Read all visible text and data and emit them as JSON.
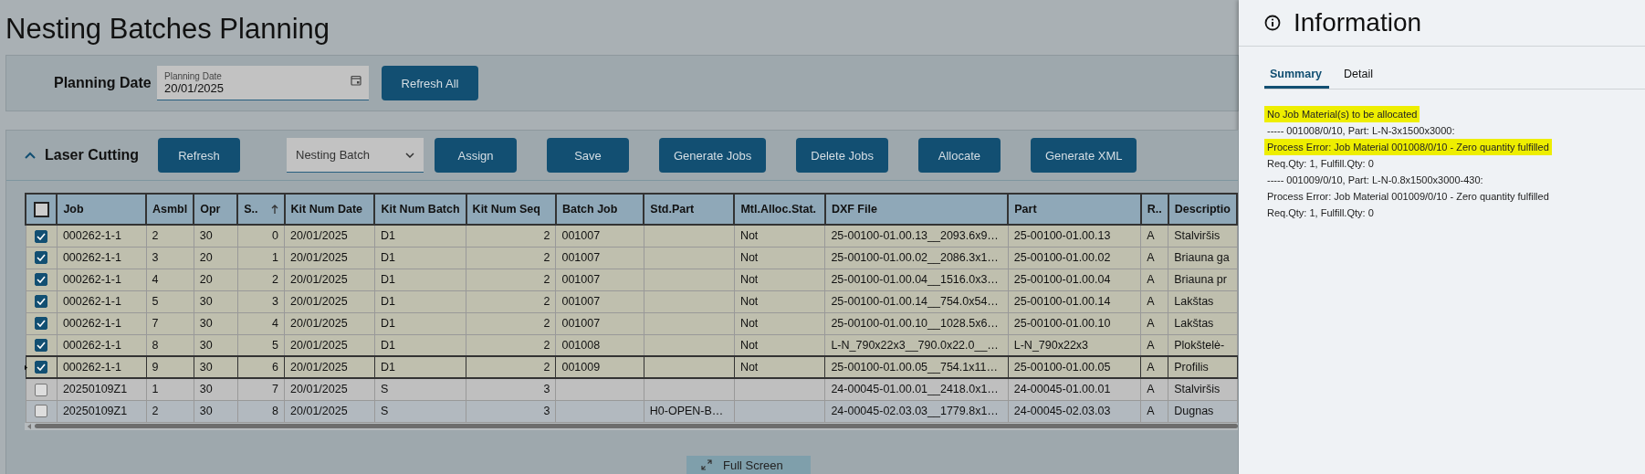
{
  "page": {
    "title": "Nesting Batches Planning"
  },
  "planning": {
    "label": "Planning Date",
    "date_field": {
      "label": "Planning Date",
      "value": "20/01/2025"
    },
    "button": "Refresh All"
  },
  "section": {
    "title": "Laser Cutting",
    "expanded": true,
    "toolbar": [
      {
        "kind": "button",
        "label": "Refresh"
      },
      {
        "kind": "dropdown",
        "label": "Nesting Batch"
      },
      {
        "kind": "button",
        "label": "Assign"
      },
      {
        "kind": "button",
        "label": "Save"
      },
      {
        "kind": "button",
        "label": "Generate Jobs"
      },
      {
        "kind": "button",
        "label": "Delete Jobs"
      },
      {
        "kind": "button",
        "label": "Allocate"
      },
      {
        "kind": "button",
        "label": "Generate XML"
      }
    ],
    "table": {
      "all_checked": false,
      "columns": [
        {
          "label": "Job",
          "kind": "text",
          "sorted": false
        },
        {
          "label": "Asmbl",
          "kind": "text",
          "sorted": false
        },
        {
          "label": "Opr",
          "kind": "text",
          "sorted": false
        },
        {
          "label": "S..",
          "kind": "number",
          "sorted": true
        },
        {
          "label": "Kit Num Date",
          "kind": "text",
          "sorted": false
        },
        {
          "label": "Kit Num Batch",
          "kind": "text",
          "sorted": false
        },
        {
          "label": "Kit Num Seq",
          "kind": "number",
          "sorted": false
        },
        {
          "label": "Batch Job",
          "kind": "text",
          "sorted": false
        },
        {
          "label": "Std.Part",
          "kind": "text",
          "sorted": false
        },
        {
          "label": "Mtl.Alloc.Stat.",
          "kind": "text",
          "sorted": false
        },
        {
          "label": "DXF File",
          "kind": "text",
          "sorted": false
        },
        {
          "label": "Part",
          "kind": "text",
          "sorted": false
        },
        {
          "label": "R..",
          "kind": "text",
          "sorted": false
        },
        {
          "label": "Descriptio",
          "kind": "text",
          "sorted": false
        }
      ],
      "rows": [
        {
          "checked": true,
          "current": false,
          "cells": [
            "000262-1-1",
            "2",
            "30",
            "0",
            "20/01/2025",
            "D1",
            "2",
            "001007",
            "",
            "Not",
            "25-00100-01.00.13__2093.6x9…",
            "25-00100-01.00.13",
            "A",
            "Stalviršis"
          ]
        },
        {
          "checked": true,
          "current": false,
          "cells": [
            "000262-1-1",
            "3",
            "20",
            "1",
            "20/01/2025",
            "D1",
            "2",
            "001007",
            "",
            "Not",
            "25-00100-01.00.02__2086.3x1…",
            "25-00100-01.00.02",
            "A",
            "Briauna ga"
          ]
        },
        {
          "checked": true,
          "current": false,
          "cells": [
            "000262-1-1",
            "4",
            "20",
            "2",
            "20/01/2025",
            "D1",
            "2",
            "001007",
            "",
            "Not",
            "25-00100-01.00.04__1516.0x3…",
            "25-00100-01.00.04",
            "A",
            "Briauna pr"
          ]
        },
        {
          "checked": true,
          "current": false,
          "cells": [
            "000262-1-1",
            "5",
            "30",
            "3",
            "20/01/2025",
            "D1",
            "2",
            "001007",
            "",
            "Not",
            "25-00100-01.00.14__754.0x54…",
            "25-00100-01.00.14",
            "A",
            "Lakštas"
          ]
        },
        {
          "checked": true,
          "current": false,
          "cells": [
            "000262-1-1",
            "7",
            "30",
            "4",
            "20/01/2025",
            "D1",
            "2",
            "001007",
            "",
            "Not",
            "25-00100-01.00.10__1028.5x6…",
            "25-00100-01.00.10",
            "A",
            "Lakštas"
          ]
        },
        {
          "checked": true,
          "current": false,
          "cells": [
            "000262-1-1",
            "8",
            "30",
            "5",
            "20/01/2025",
            "D1",
            "2",
            "001008",
            "",
            "Not",
            "L-N_790x22x3__790.0x22.0__…",
            "L-N_790x22x3",
            "A",
            "Plokštelė-"
          ]
        },
        {
          "checked": true,
          "current": true,
          "cells": [
            "000262-1-1",
            "9",
            "30",
            "6",
            "20/01/2025",
            "D1",
            "2",
            "001009",
            "",
            "Not",
            "25-00100-01.00.05__754.1x11…",
            "25-00100-01.00.05",
            "A",
            "Profilis"
          ]
        },
        {
          "checked": false,
          "current": false,
          "cells": [
            "20250109Z1",
            "1",
            "30",
            "7",
            "20/01/2025",
            "S",
            "3",
            "",
            "",
            "",
            "24-00045-01.00.01__2418.0x1…",
            "24-00045-01.00.01",
            "A",
            "Stalviršis"
          ]
        },
        {
          "checked": false,
          "current": false,
          "cells": [
            "20250109Z1",
            "2",
            "30",
            "8",
            "20/01/2025",
            "S",
            "3",
            "",
            "H0-OPEN-B…",
            "",
            "24-00045-02.03.03__1779.8x1…",
            "24-00045-02.03.03",
            "A",
            "Dugnas"
          ]
        }
      ]
    },
    "full_screen": "Full Screen"
  },
  "info_panel": {
    "title": "Information",
    "tabs": [
      {
        "label": "Summary",
        "selected": true
      },
      {
        "label": "Detail",
        "selected": false
      }
    ],
    "messages": [
      {
        "text": "No Job Material(s) to be allocated",
        "highlighted": true
      },
      {
        "text": "----- 001008/0/10, Part: L-N-3x1500x3000:",
        "highlighted": false
      },
      {
        "text": "Process Error: Job Material 001008/0/10 - Zero quantity fulfilled",
        "highlighted": true
      },
      {
        "text": "Req.Qty: 1, Fulfill.Qty: 0",
        "highlighted": false
      },
      {
        "text": "----- 001009/0/10, Part: L-N-0.8x1500x3000-430:",
        "highlighted": false
      },
      {
        "text": "Process Error: Job Material 001009/0/10 - Zero quantity fulfilled",
        "highlighted": false
      },
      {
        "text": "Req.Qty: 1, Fulfill.Qty: 0",
        "highlighted": false
      }
    ]
  }
}
